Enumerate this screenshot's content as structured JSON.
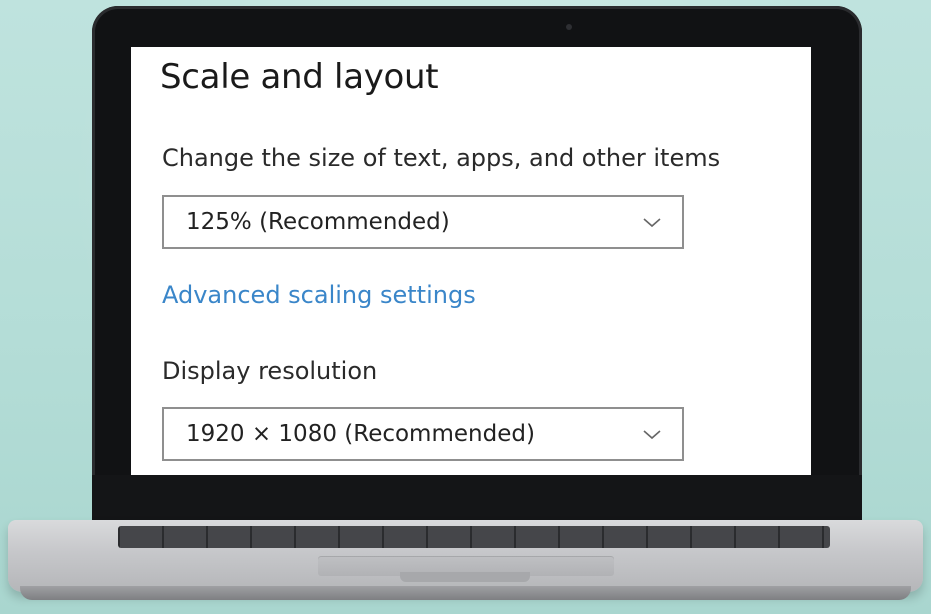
{
  "settings": {
    "title": "Scale and layout",
    "scale_label": "Change the size of text, apps, and other items",
    "scale_value": "125% (Recommended)",
    "advanced_link": "Advanced scaling settings",
    "resolution_label": "Display resolution",
    "resolution_value": "1920 × 1080 (Recommended)"
  },
  "icons": {
    "dropdown": "chevron-down-icon"
  },
  "colors": {
    "link": "#3a86c9",
    "text": "#1a1a1a",
    "border": "#8f8f8f"
  }
}
